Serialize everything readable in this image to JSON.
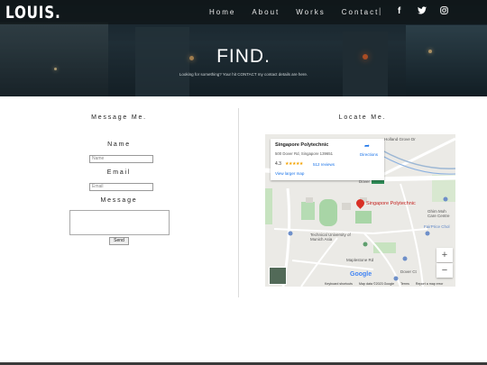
{
  "logo": "LOUIS.",
  "nav": [
    "Home",
    "About",
    "Works",
    "Contact"
  ],
  "nav_separator": "|",
  "social_icons": [
    "facebook-icon",
    "twitter-icon",
    "instagram-icon"
  ],
  "hero": {
    "title": "FIND.",
    "subtitle": "Looking for something? Your hit CONTACT my contact details are here."
  },
  "message_form": {
    "title": "Message Me.",
    "name_label": "Name",
    "name_placeholder": "Name",
    "email_label": "Email",
    "email_placeholder": "Email",
    "message_label": "Message",
    "send_label": "Send"
  },
  "locate": {
    "title": "Locate Me.",
    "place_name": "Singapore Polytechnic",
    "address": "500 Dover Rd, Singapore 139651",
    "rating": "4.3",
    "stars": "★★★★★",
    "reviews": "512 reviews",
    "larger_map": "View larger map",
    "directions": "Directions",
    "pin_label": "Singapore Polytechnic",
    "street_labels": [
      "Holland Grove Dr",
      "Dover",
      "Technical University of Munich Asia",
      "Maplestone Rd",
      "Dover Ct",
      "FairPrice Chol",
      "Ghim Moh Care Centre"
    ],
    "footer": [
      "Keyboard shortcuts",
      "Map data ©2023 Google",
      "Terms",
      "Report a map error"
    ],
    "google": "Google",
    "zoom_in": "+",
    "zoom_out": "−"
  },
  "colors": {
    "accent_link": "#1a73e8",
    "pin": "#d93025",
    "star": "#f4a300"
  }
}
